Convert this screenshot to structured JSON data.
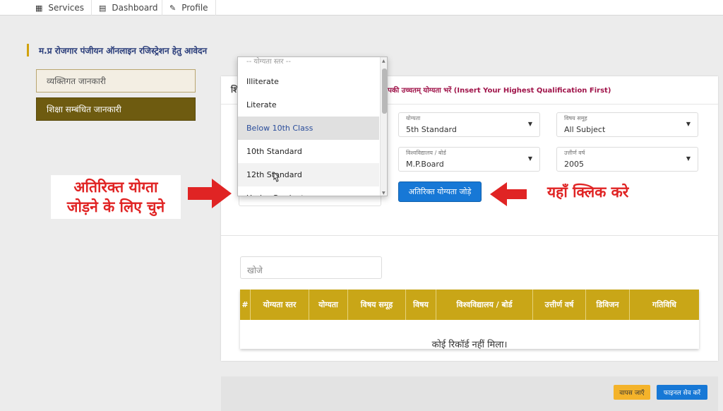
{
  "topnav": {
    "items": [
      {
        "label": "Services",
        "icon": "building-icon"
      },
      {
        "label": "Dashboard",
        "icon": "dashboard-icon"
      },
      {
        "label": "Profile",
        "icon": "pen-icon"
      }
    ]
  },
  "page_title": "म.प्र रोजगार पंजीयन ऑनलाइन रजिस्ट्रेशन हेतु आवेदन",
  "sidebar": {
    "items": [
      {
        "label": "व्यक्तिगत जानकारी",
        "active": false
      },
      {
        "label": "शिक्षा सम्बंधित जानकारी",
        "active": true
      }
    ]
  },
  "panel": {
    "header_partial": "शि",
    "qualification_note": "आपकी उच्चतम् योग्यता भरें (Insert Your Highest Qualification First)",
    "fields": {
      "yogyata": {
        "label": "योग्यता",
        "value": "5th Standard"
      },
      "vishay_samooh": {
        "label": "विषय समूह",
        "value": "All Subject"
      },
      "board": {
        "label": "विश्वविद्यालय / बोर्ड",
        "value": "M.P.Board"
      },
      "uttirn_varsh": {
        "label": "उत्तीर्ण वर्ष",
        "value": "2005"
      }
    },
    "add_button": "अतिरिक्त योग्यता जोड़े"
  },
  "dropdown": {
    "hint": "-- योग्यता स्तर --",
    "options": [
      "Illiterate",
      "Literate",
      "Below 10th Class",
      "10th Standard",
      "12th Standard",
      "Under Graduate"
    ],
    "selected": "Below 10th Class",
    "hovered": "12th Standard"
  },
  "search": {
    "placeholder": "खोजे"
  },
  "table": {
    "columns": [
      "#",
      "योग्यता स्तर",
      "योग्यता",
      "विषय समूह",
      "विषय",
      "विश्वविद्यालय / बोर्ड",
      "उत्तीर्ण वर्ष",
      "डिविजन",
      "गतिविधि"
    ],
    "empty_message": "कोई रिकॉर्ड नहीं मिला।"
  },
  "footer": {
    "back_button": "वापस जाएँ",
    "save_button": "फाइनल सेव करें"
  },
  "annotations": {
    "left_line1": "अतिरिक्त योग्ता",
    "left_line2": "जोड़ने के लिए चुने",
    "right": "यहाँ क्लिक करे"
  },
  "colors": {
    "accent_gold": "#c9a617",
    "primary_blue": "#1778d6",
    "annotation_red": "#e02424",
    "sidebar_active": "#6e5b10"
  }
}
